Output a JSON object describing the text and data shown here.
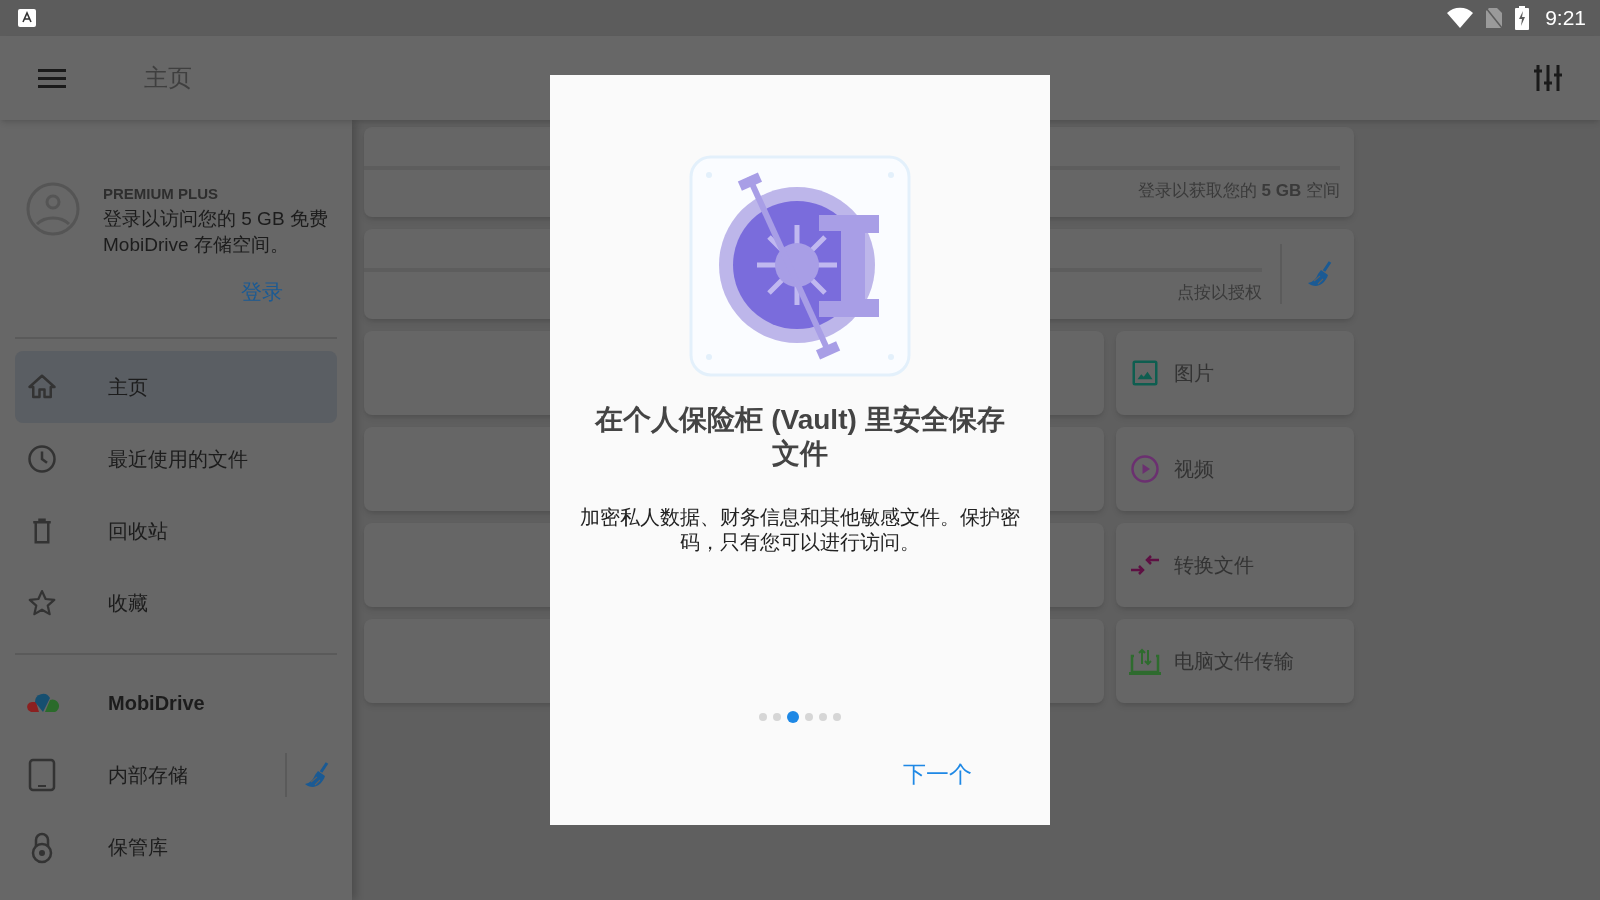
{
  "status_bar": {
    "time": "9:21"
  },
  "app_bar": {
    "title": "主页"
  },
  "drawer": {
    "account": {
      "tier": "PREMIUM PLUS",
      "message": "登录以访问您的 5 GB 免费 MobiDrive 存储空间。",
      "login": "登录"
    },
    "items": [
      {
        "label": "主页",
        "kind": "home",
        "selected": true
      },
      {
        "label": "最近使用的文件",
        "kind": "clock",
        "selected": false
      },
      {
        "label": "回收站",
        "kind": "trash",
        "selected": false
      },
      {
        "label": "收藏",
        "kind": "star",
        "selected": false
      }
    ],
    "storage": [
      {
        "label": "MobiDrive",
        "kind": "cloud"
      },
      {
        "label": "内部存储",
        "kind": "tablet"
      },
      {
        "label": "保管库",
        "kind": "lock"
      }
    ]
  },
  "storage_cards": [
    {
      "kind": "account",
      "caption": "登录以获取您的 **5 GB** 空间"
    },
    {
      "kind": "authorize",
      "caption": "点按以授权"
    }
  ],
  "tiles": [
    {
      "label": "图片",
      "kind": "image"
    },
    {
      "label": "视频",
      "kind": "video"
    },
    {
      "label": "转换文件",
      "kind": "convert"
    },
    {
      "label": "电脑文件传输",
      "kind": "transfer"
    }
  ],
  "dialog": {
    "title": "在个人保险柜 (Vault) 里安全保存文件",
    "body": "加密私人数据、财务信息和其他敏感文件。保护密码，只有您可以进行访问。",
    "pager": [
      {
        "selected": false
      },
      {
        "selected": false
      },
      {
        "selected": true
      },
      {
        "selected": false
      },
      {
        "selected": false
      },
      {
        "selected": false
      }
    ],
    "next": "下一个"
  }
}
